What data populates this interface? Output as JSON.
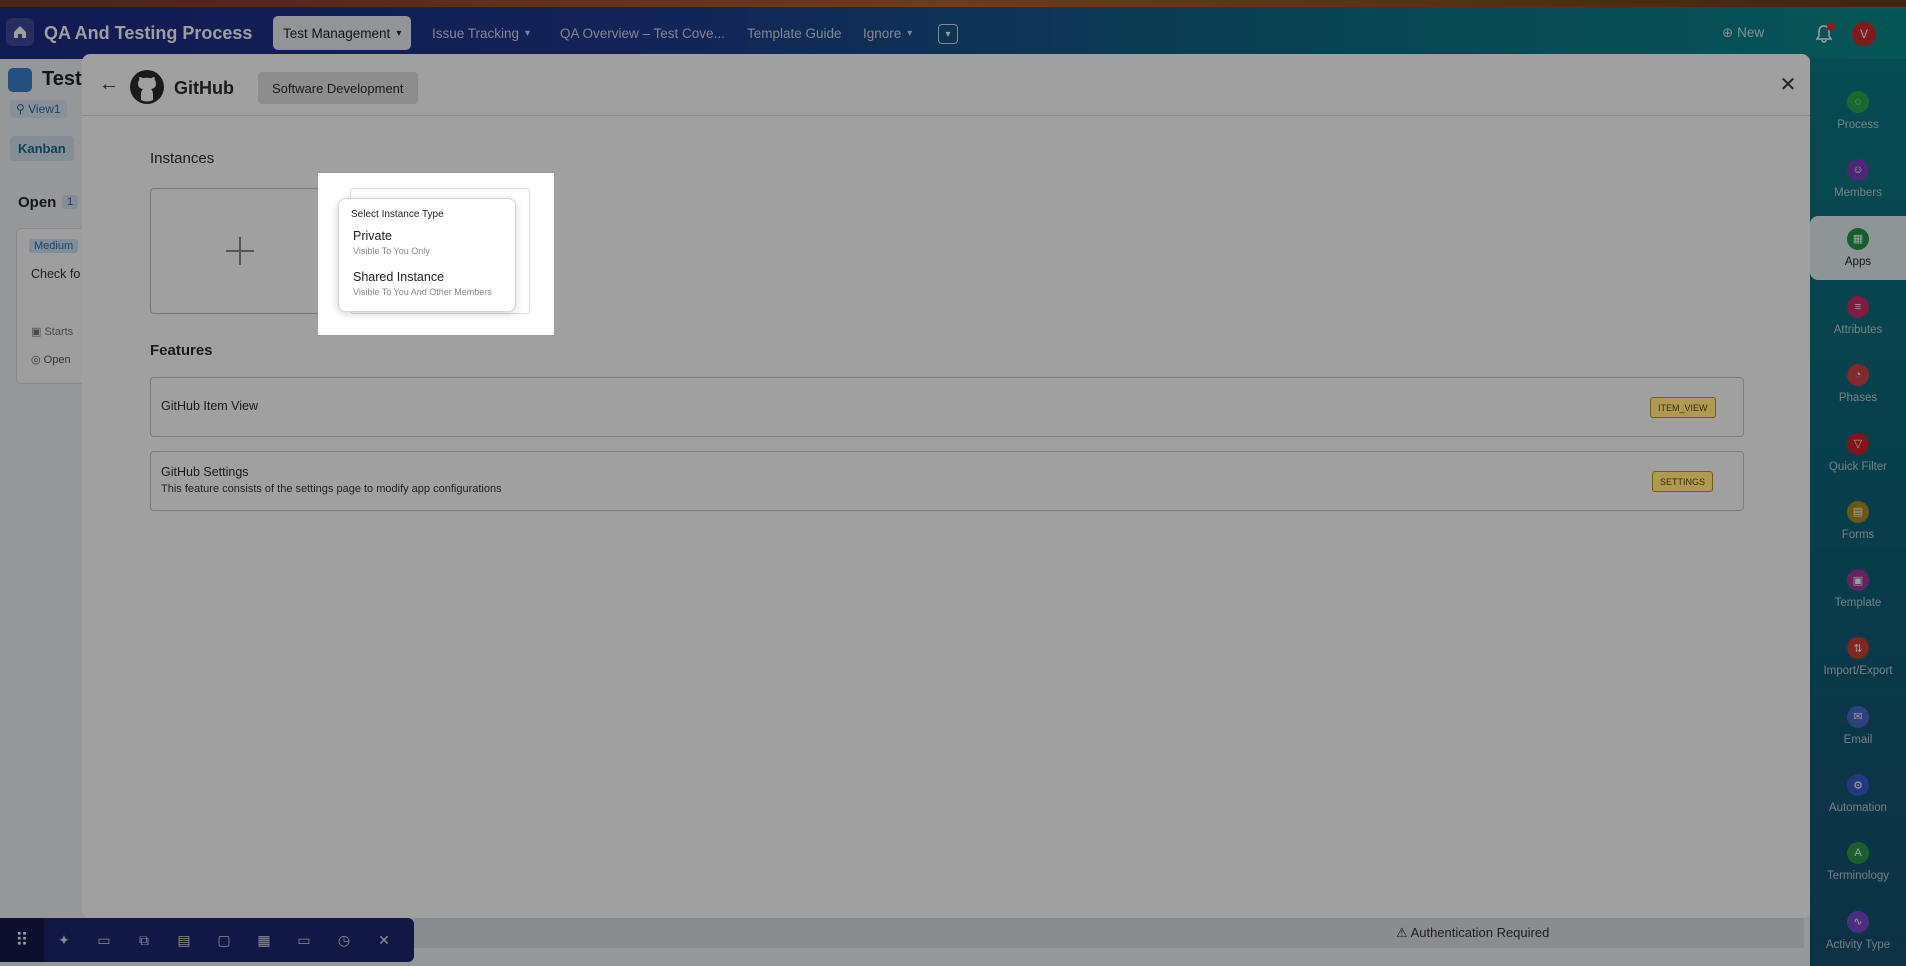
{
  "topbar": {
    "workspace_title": "QA And Testing Process",
    "nav": [
      {
        "label": "Test Management",
        "active": true,
        "has_chevron": true
      },
      {
        "label": "Issue Tracking",
        "active": false,
        "has_chevron": true
      },
      {
        "label": "QA Overview – Test Cove...",
        "active": false,
        "has_chevron": false
      },
      {
        "label": "Template Guide",
        "active": false,
        "has_chevron": false
      },
      {
        "label": "Ignore",
        "active": false,
        "has_chevron": true
      }
    ],
    "new_label": "New",
    "avatar_initial": "V"
  },
  "background": {
    "page_title": "Test",
    "view_label": "View1",
    "kanban_label": "Kanban",
    "column_title": "Open",
    "column_count": "1",
    "card": {
      "badge": "Medium",
      "text": "Check fo and disa any bugs",
      "meta_starts": "Starts",
      "meta_status": "Open"
    },
    "auth_text": "Authentication Required"
  },
  "rail": {
    "items": [
      {
        "label": "Process",
        "icon": "process-icon",
        "color": "#2aa84a"
      },
      {
        "label": "Members",
        "icon": "members-icon",
        "color": "#7a3fc0"
      },
      {
        "label": "Apps",
        "icon": "apps-icon",
        "color": "#1f9a4a",
        "active": true
      },
      {
        "label": "Attributes",
        "icon": "attributes-icon",
        "color": "#c8306a"
      },
      {
        "label": "Phases",
        "icon": "phases-icon",
        "color": "#d0454a"
      },
      {
        "label": "Quick Filter",
        "icon": "filter-icon",
        "color": "#d81e2a"
      },
      {
        "label": "Forms",
        "icon": "forms-icon",
        "color": "#b08a20"
      },
      {
        "label": "Template",
        "icon": "template-icon",
        "color": "#a03aa0"
      },
      {
        "label": "Import/Export",
        "icon": "import-export-icon",
        "color": "#d04030"
      },
      {
        "label": "Email",
        "icon": "email-icon",
        "color": "#4a6ad0"
      },
      {
        "label": "Automation",
        "icon": "automation-icon",
        "color": "#3a5ad0"
      },
      {
        "label": "Terminology",
        "icon": "terminology-icon",
        "color": "#2a9a4a"
      },
      {
        "label": "Activity Type",
        "icon": "activity-icon",
        "color": "#7a4ad0"
      }
    ]
  },
  "modal": {
    "app_name": "GitHub",
    "category": "Software Development",
    "instances_heading": "Instances",
    "dropdown": {
      "title": "Select Instance Type",
      "options": [
        {
          "label": "Private",
          "sub": "Visible To You Only"
        },
        {
          "label": "Shared Instance",
          "sub": "Visible To You And Other Members"
        }
      ]
    },
    "features_heading": "Features",
    "features": [
      {
        "name": "GitHub Item View",
        "description": "",
        "tag": "ITEM_VIEW"
      },
      {
        "name": "GitHub Settings",
        "description": "This feature consists of the settings page to modify app configurations",
        "tag": "SETTINGS"
      }
    ]
  },
  "colors": {
    "modal_bg": "#a0a0a0",
    "tag_bg": "#b09a52",
    "rail_active_bg": "#ffffff"
  }
}
